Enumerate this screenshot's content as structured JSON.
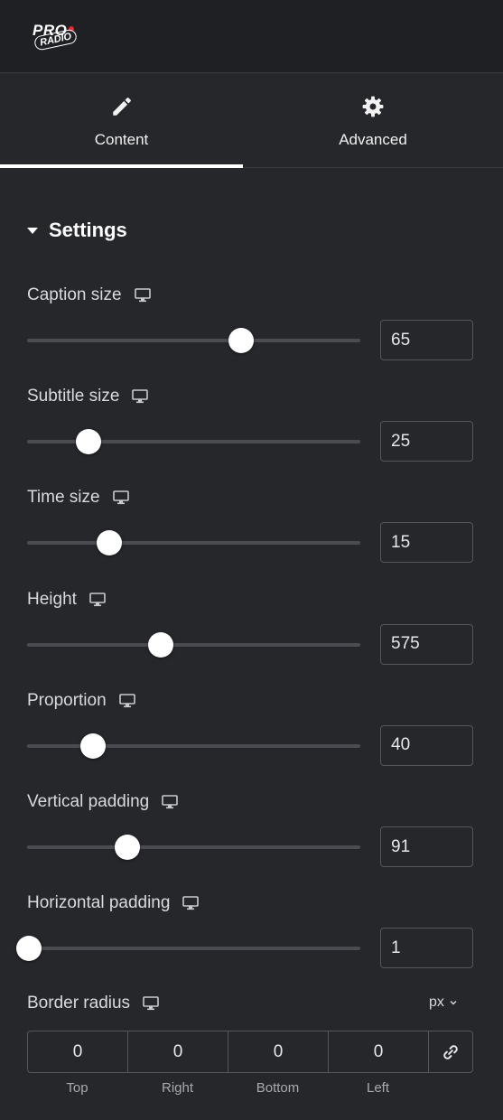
{
  "logo": {
    "line1": "PRO",
    "line2": "RADIO"
  },
  "tabs": [
    {
      "label": "Content",
      "icon": "pencil-icon",
      "active": true
    },
    {
      "label": "Advanced",
      "icon": "gear-icon",
      "active": false
    }
  ],
  "section": {
    "title": "Settings"
  },
  "controls": [
    {
      "label": "Caption size",
      "value": "65",
      "slider_fraction": 0.643
    },
    {
      "label": "Subtitle size",
      "value": "25",
      "slider_fraction": 0.184
    },
    {
      "label": "Time size",
      "value": "15",
      "slider_fraction": 0.247
    },
    {
      "label": "Height",
      "value": "575",
      "slider_fraction": 0.401
    },
    {
      "label": "Proportion",
      "value": "40",
      "slider_fraction": 0.198
    },
    {
      "label": "Vertical padding",
      "value": "91",
      "slider_fraction": 0.301
    },
    {
      "label": "Horizontal padding",
      "value": "1",
      "slider_fraction": 0.005
    }
  ],
  "border_radius": {
    "label": "Border radius",
    "unit": "px",
    "values": [
      "0",
      "0",
      "0",
      "0"
    ],
    "sides": [
      "Top",
      "Right",
      "Bottom",
      "Left"
    ]
  },
  "colors": {
    "background": "#26272b",
    "topbar": "#1f2024",
    "accent_red": "#e8262d",
    "active_tab_bar": "#ffffff"
  }
}
